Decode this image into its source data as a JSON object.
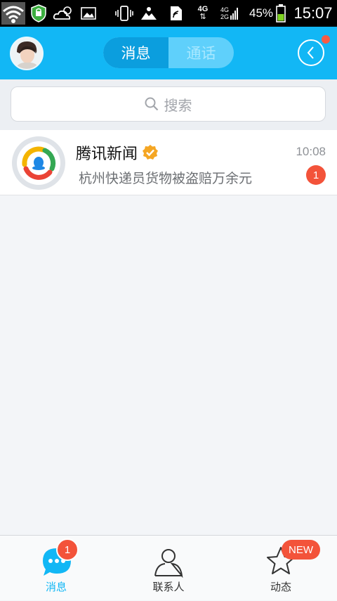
{
  "status_bar": {
    "battery": "45%",
    "time": "15:07",
    "network_primary": "4G",
    "network_secondary_top": "4G",
    "network_secondary_bottom": "2G",
    "icons": [
      "wifi-icon",
      "shield-icon",
      "cloud-sun-icon",
      "image-icon",
      "vibrate-icon",
      "landscape-icon",
      "nfc-icon",
      "battery-icon"
    ]
  },
  "header": {
    "tab_messages": "消息",
    "tab_calls": "通话",
    "active_tab": "消息",
    "colors": {
      "bar": "#12b7f5",
      "active_tab": "#0b9ede"
    }
  },
  "search": {
    "placeholder": "搜索"
  },
  "conversations": [
    {
      "name": "腾讯新闻",
      "verified": true,
      "time": "10:08",
      "preview": "杭州快递员货物被盗赔万余元",
      "unread": "1"
    }
  ],
  "tabbar": {
    "tabs": [
      {
        "label": "消息",
        "badge": "1",
        "active": true
      },
      {
        "label": "联系人"
      },
      {
        "label": "动态",
        "badge": "NEW"
      }
    ],
    "colors": {
      "active": "#12b7f5",
      "inactive": "#333333"
    }
  }
}
